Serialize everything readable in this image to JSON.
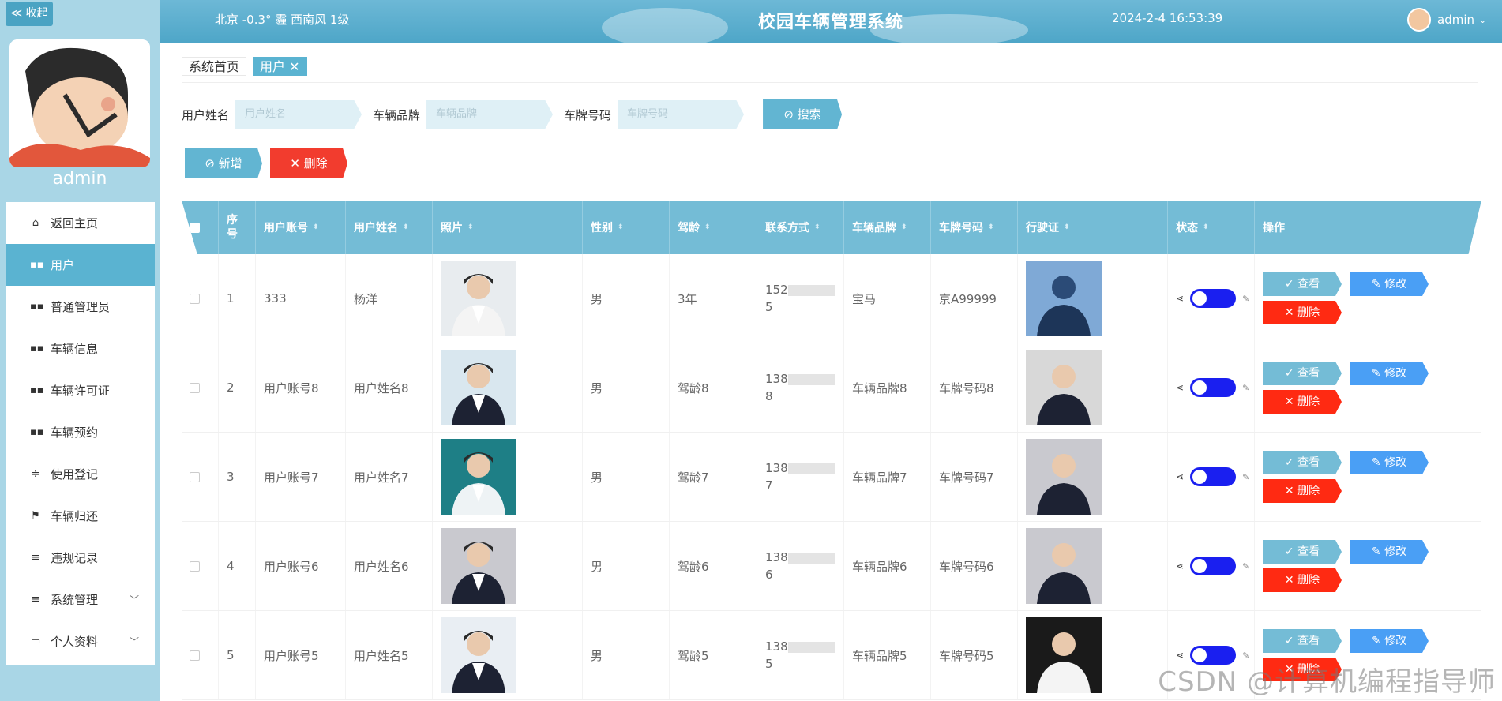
{
  "sidebar": {
    "collapse_label": "≪ 收起",
    "username": "admin",
    "items": [
      {
        "label": "返回主页",
        "icon": "home-icon",
        "active": false
      },
      {
        "label": "用户",
        "icon": "grid-icon",
        "active": true
      },
      {
        "label": "普通管理员",
        "icon": "grid-icon",
        "active": false
      },
      {
        "label": "车辆信息",
        "icon": "grid-icon",
        "active": false
      },
      {
        "label": "车辆许可证",
        "icon": "grid-icon",
        "active": false
      },
      {
        "label": "车辆预约",
        "icon": "grid-icon",
        "active": false
      },
      {
        "label": "使用登记",
        "icon": "sliders-icon",
        "active": false
      },
      {
        "label": "车辆归还",
        "icon": "flag-icon",
        "active": false
      },
      {
        "label": "违规记录",
        "icon": "list-icon",
        "active": false
      },
      {
        "label": "系统管理",
        "icon": "list-icon",
        "active": false
      },
      {
        "label": "个人资料",
        "icon": "card-icon",
        "active": false
      }
    ]
  },
  "header": {
    "weather": "北京  -0.3°  霾  西南风  1级",
    "title": "校园车辆管理系统",
    "datetime": "2024-2-4 16:53:39",
    "user": "admin"
  },
  "tabs": [
    {
      "label": "系统首页"
    },
    {
      "label": "用户 ✕"
    }
  ],
  "search": {
    "name_label": "用户姓名",
    "name_placeholder": "用户姓名",
    "brand_label": "车辆品牌",
    "brand_placeholder": "车辆品牌",
    "plate_label": "车牌号码",
    "plate_placeholder": "车牌号码",
    "search_button": "搜索"
  },
  "actions": {
    "add": "新增",
    "delete": "删除"
  },
  "table": {
    "headers": {
      "index": "序号",
      "account": "用户账号",
      "name": "用户姓名",
      "photo": "照片",
      "gender": "性别",
      "driving_age": "驾龄",
      "phone": "联系方式",
      "brand": "车辆品牌",
      "plate": "车牌号码",
      "license": "行驶证",
      "status": "状态",
      "ops": "操作"
    },
    "ops_labels": {
      "view": "查看",
      "modify": "修改",
      "delete": "删除"
    },
    "rows": [
      {
        "index": "1",
        "account": "333",
        "name": "杨洋",
        "gender": "男",
        "driving_age": "3年",
        "phone_head": "152",
        "phone_tail": "5",
        "brand": "宝马",
        "plate": "京A99999"
      },
      {
        "index": "2",
        "account": "用户账号8",
        "name": "用户姓名8",
        "gender": "男",
        "driving_age": "驾龄8",
        "phone_head": "138",
        "phone_tail": "8",
        "brand": "车辆品牌8",
        "plate": "车牌号码8"
      },
      {
        "index": "3",
        "account": "用户账号7",
        "name": "用户姓名7",
        "gender": "男",
        "driving_age": "驾龄7",
        "phone_head": "138",
        "phone_tail": "7",
        "brand": "车辆品牌7",
        "plate": "车牌号码7"
      },
      {
        "index": "4",
        "account": "用户账号6",
        "name": "用户姓名6",
        "gender": "男",
        "driving_age": "驾龄6",
        "phone_head": "138",
        "phone_tail": "6",
        "brand": "车辆品牌6",
        "plate": "车牌号码6"
      },
      {
        "index": "5",
        "account": "用户账号5",
        "name": "用户姓名5",
        "gender": "男",
        "driving_age": "驾龄5",
        "phone_head": "138",
        "phone_tail": "5",
        "brand": "车辆品牌5",
        "plate": "车牌号码5"
      }
    ]
  },
  "watermark": "CSDN @计算机编程指导师",
  "colors": {
    "accent": "#5ab3d1",
    "header": "#74bcd6",
    "danger": "#f23c2e",
    "toggle": "#1a1ff0",
    "modify": "#4a9ff5"
  }
}
